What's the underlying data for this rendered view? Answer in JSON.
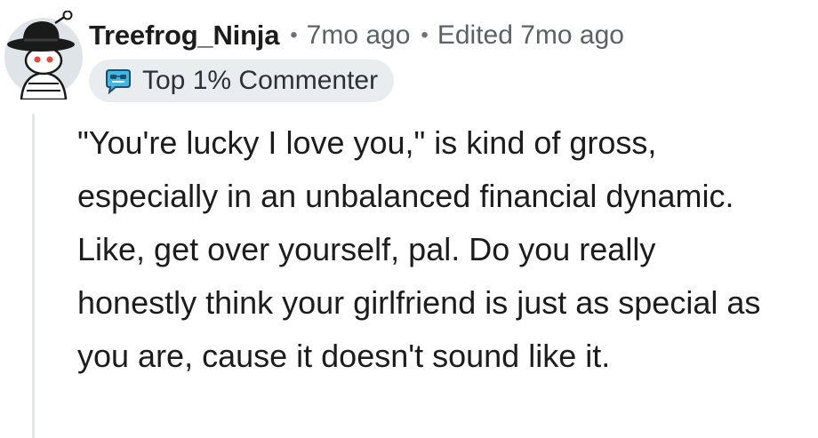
{
  "comment": {
    "username": "Treefrog_Ninja",
    "timestamp": "7mo ago",
    "edited": "Edited 7mo ago",
    "flair": "Top 1% Commenter",
    "body": "\"You're lucky I love you,\" is kind of gross, especially in an unbalanced financial dynamic. Like, get over yourself, pal. Do you really honestly think your girlfriend is just as special as you are, cause it doesn't sound like it."
  },
  "icons": {
    "avatar": "snoo-avatar-icon",
    "flair_badge": "top-commenter-badge-icon",
    "separator": "•"
  },
  "colors": {
    "username": "#1c1c1c",
    "meta": "#5c6166",
    "flair_background": "#eaedef",
    "thread_line": "#e3e6e8",
    "badge_accent": "#3fb8e8"
  }
}
